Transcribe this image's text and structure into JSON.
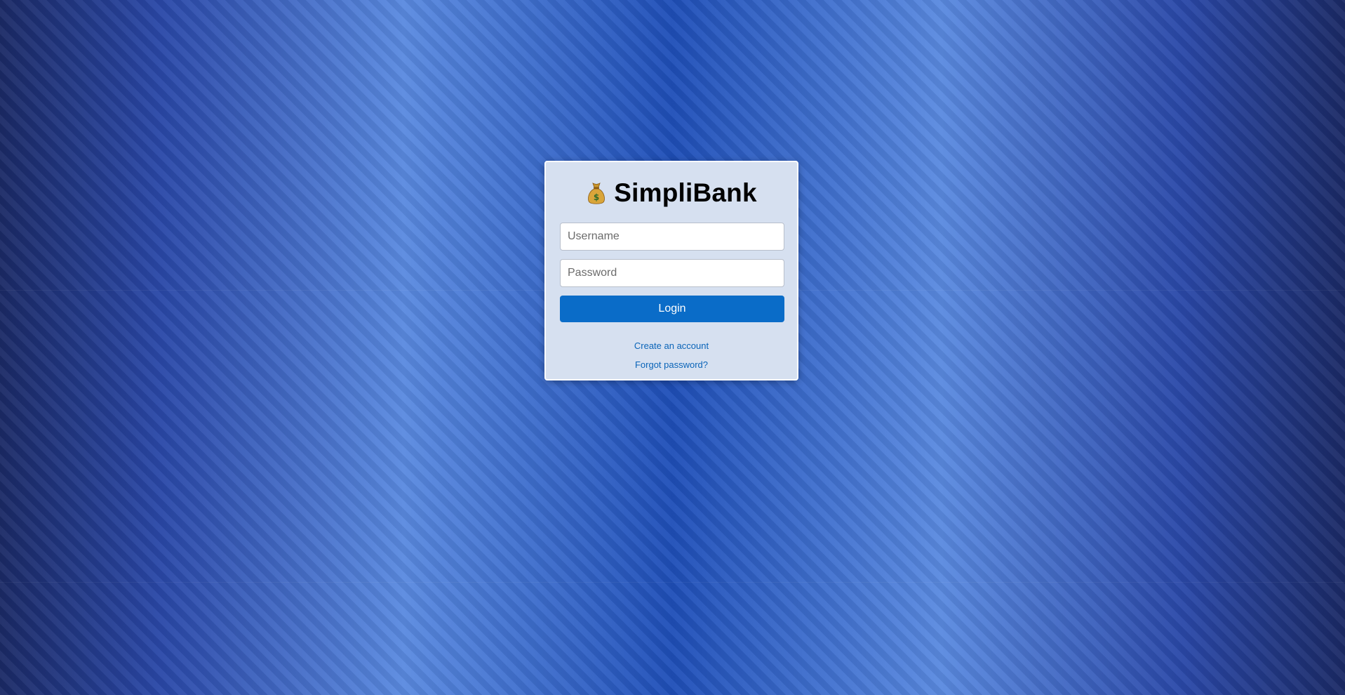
{
  "app": {
    "name": "SimpliBank",
    "icon": "money-bag-icon"
  },
  "login_form": {
    "username_placeholder": "Username",
    "username_value": "",
    "password_placeholder": "Password",
    "password_value": "",
    "login_label": "Login"
  },
  "links": {
    "create_account": "Create an account",
    "forgot_password": "Forgot password?"
  },
  "colors": {
    "primary_button": "#0a6cc8",
    "link": "#0a64b8",
    "card_background": "#d6e0f0",
    "page_background": "#2f5bc4"
  }
}
